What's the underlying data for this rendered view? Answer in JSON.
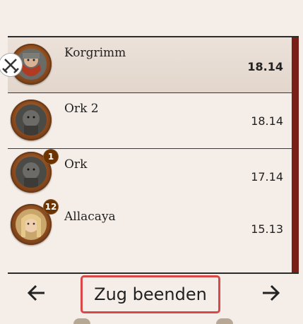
{
  "combatants": [
    {
      "name": "Korgrimm",
      "value": "18.14",
      "active": true,
      "badge": "",
      "has_swords": true,
      "portrait": "dwarf-portrait-icon"
    },
    {
      "name": "Ork 2",
      "value": "18.14",
      "active": false,
      "badge": "",
      "has_swords": false,
      "portrait": "orc-portrait-icon"
    },
    {
      "name": "Ork",
      "value": "17.14",
      "active": false,
      "badge": "1",
      "has_swords": false,
      "portrait": "orc-portrait-icon"
    },
    {
      "name": "Allacaya",
      "value": "15.13",
      "active": false,
      "badge": "12",
      "has_swords": false,
      "portrait": "elf-portrait-icon"
    }
  ],
  "footer": {
    "end_turn_label": "Zug beenden",
    "prev_icon": "arrow-left-icon",
    "next_icon": "arrow-right-icon"
  },
  "colors": {
    "scrollbar": "#7a1f17",
    "badge": "#6a3300",
    "highlight_border": "#d94848"
  }
}
